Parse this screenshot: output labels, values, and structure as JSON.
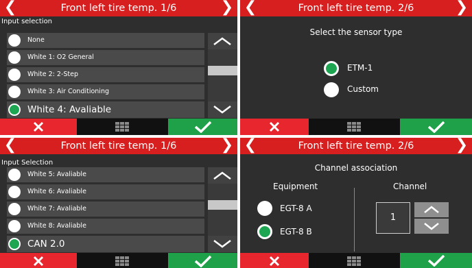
{
  "panels": {
    "p1": {
      "title": "Front left tire temp. 1/6",
      "list_label": "Input selection",
      "items": [
        {
          "label": "None",
          "selected": false
        },
        {
          "label": "White 1: O2 General",
          "selected": false
        },
        {
          "label": "White 2: 2-Step",
          "selected": false
        },
        {
          "label": "White 3: Air Conditioning",
          "selected": false
        },
        {
          "label": "White 4: Avaliable",
          "selected": true
        }
      ]
    },
    "p2": {
      "title": "Front left tire temp. 2/6",
      "heading": "Select the sensor type",
      "options": [
        {
          "label": "ETM-1",
          "selected": true
        },
        {
          "label": "Custom",
          "selected": false
        }
      ]
    },
    "p3": {
      "title": "Front left tire temp. 1/6",
      "list_label": "Input Selection",
      "items": [
        {
          "label": "White 5: Avaliable",
          "selected": false
        },
        {
          "label": "White 6: Avaliable",
          "selected": false
        },
        {
          "label": "White 7: Avaliable",
          "selected": false
        },
        {
          "label": "White 8: Avaliable",
          "selected": false
        },
        {
          "label": "CAN 2.0",
          "selected": true
        }
      ]
    },
    "p4": {
      "title": "Front left tire temp. 2/6",
      "heading": "Channel association",
      "equipment_label": "Equipment",
      "channel_label": "Channel",
      "options": [
        {
          "label": "EGT-8 A",
          "selected": false
        },
        {
          "label": "EGT-8 B",
          "selected": true
        }
      ],
      "channel_value": "1"
    }
  },
  "icons": {
    "prev": "chevron-left-icon",
    "next": "chevron-right-icon",
    "cancel": "x-icon",
    "menu": "grid-icon",
    "confirm": "check-icon",
    "scroll_up": "chevron-up-icon",
    "scroll_down": "chevron-down-icon"
  },
  "colors": {
    "header": "#d81f1f",
    "cancel": "#e8262e",
    "confirm": "#1fa14a",
    "selected_radio": "#1da552",
    "panel_bg": "#2e2e2e"
  }
}
